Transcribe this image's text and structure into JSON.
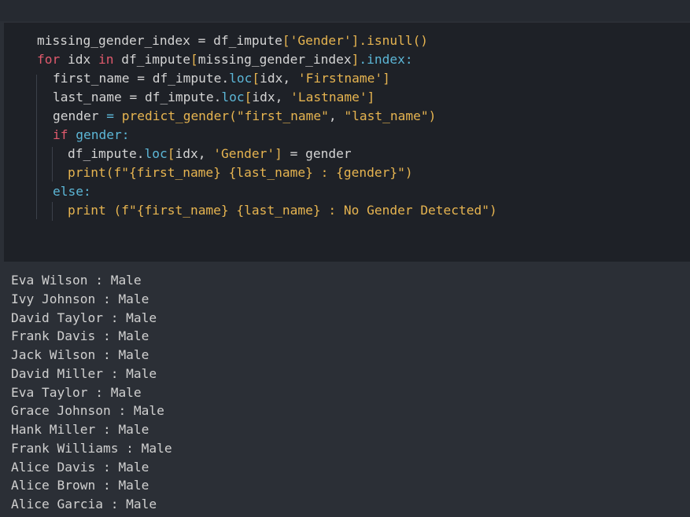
{
  "code": {
    "lines": [
      [
        "missing_gender_index = df_impute",
        "[",
        "'Gender'",
        "]",
        ".isnull()"
      ],
      [
        "for",
        " idx ",
        "in",
        " df_impute",
        "[",
        "missing_gender_index",
        "]",
        ".index",
        ":"
      ],
      [
        "first_name = df_impute.",
        "loc",
        "[",
        "idx, ",
        "'Firstname'",
        "]"
      ],
      [
        "last_name = df_impute.",
        "loc",
        "[",
        "idx, ",
        "'Lastname'",
        "]"
      ],
      [
        "gender ",
        "=",
        " predict_gender",
        "(",
        "\"first_name\"",
        ", ",
        "\"last_name\"",
        ")"
      ],
      [
        "if",
        " gender",
        ":"
      ],
      [
        "df_impute.",
        "loc",
        "[",
        "idx, ",
        "'Gender'",
        "]",
        " = gender"
      ],
      [
        "print",
        "(",
        "f\"{first_name} {last_name} : {gender}\"",
        ")"
      ],
      [
        "else",
        ":"
      ],
      [
        "print",
        " (",
        "f\"{first_name} {last_name} : No Gender Detected\"",
        ")"
      ]
    ]
  },
  "output": {
    "lines": [
      "Eva Wilson : Male",
      "Ivy Johnson : Male",
      "David Taylor : Male",
      "Frank Davis : Male",
      "Jack Wilson : Male",
      "David Miller : Male",
      "Eva Taylor : Male",
      "Grace Johnson : Male",
      "Hank Miller : Male",
      "Frank Williams : Male",
      "Alice Davis : Male",
      "Alice Brown : Male",
      "Alice Garcia : Male"
    ]
  },
  "colors": {
    "keyword": "#e05a6d",
    "string": "#e6b450",
    "attribute": "#5cb6d6",
    "text": "#d4d4d4",
    "cell_bg": "#1e2127",
    "page_bg": "#2b2f36"
  }
}
